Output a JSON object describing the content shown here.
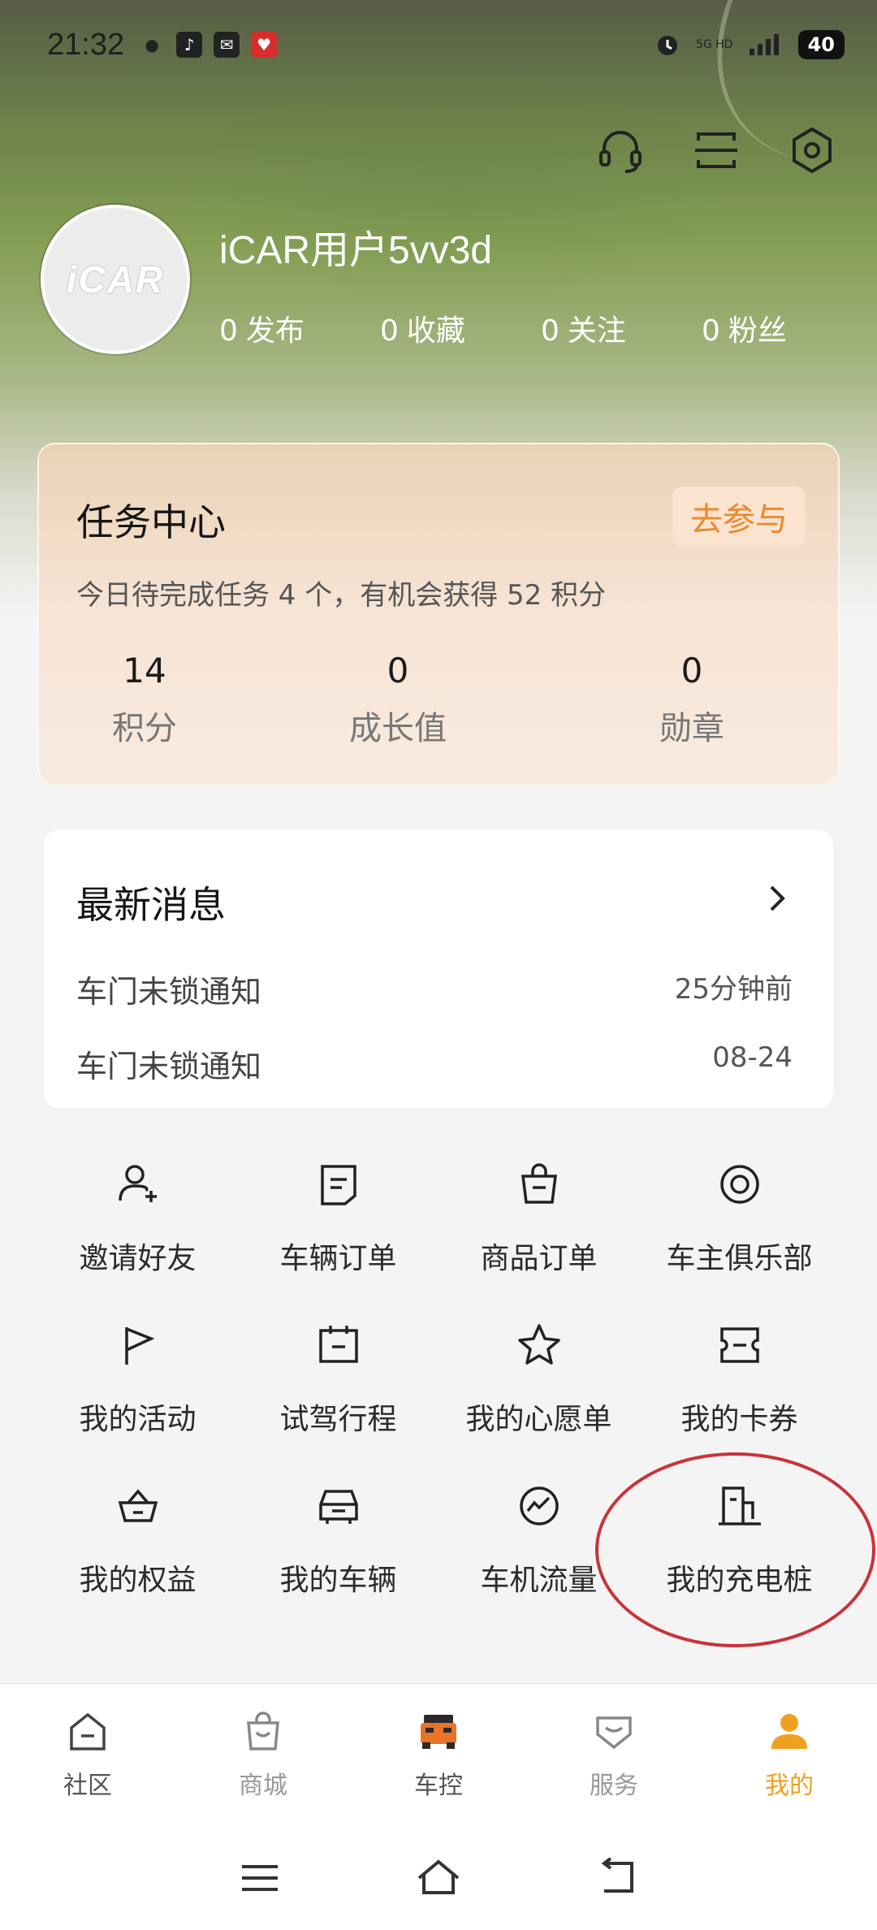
{
  "status_bar": {
    "time": "21:32",
    "network": "5G HD",
    "battery": "40"
  },
  "profile": {
    "avatar_text": "iCAR",
    "username": "iCAR用户5vv3d",
    "stats": [
      {
        "num": "0",
        "label": "发布"
      },
      {
        "num": "0",
        "label": "收藏"
      },
      {
        "num": "0",
        "label": "关注"
      },
      {
        "num": "0",
        "label": "粉丝"
      }
    ]
  },
  "task_center": {
    "title": "任务中心",
    "join_label": "去参与",
    "description": "今日待完成任务 4 个，有机会获得 52 积分",
    "stats": [
      {
        "value": "14",
        "label": "积分"
      },
      {
        "value": "0",
        "label": "成长值"
      },
      {
        "value": "0",
        "label": "勋章"
      }
    ]
  },
  "messages": {
    "title": "最新消息",
    "items": [
      {
        "text": "车门未锁通知",
        "time": "25分钟前"
      },
      {
        "text": "车门未锁通知",
        "time": "08-24"
      }
    ]
  },
  "menu": {
    "items": [
      {
        "label": "邀请好友",
        "icon": "invite-friend-icon"
      },
      {
        "label": "车辆订单",
        "icon": "vehicle-order-icon"
      },
      {
        "label": "商品订单",
        "icon": "product-order-icon"
      },
      {
        "label": "车主俱乐部",
        "icon": "owner-club-icon"
      },
      {
        "label": "我的活动",
        "icon": "flag-icon"
      },
      {
        "label": "试驾行程",
        "icon": "calendar-icon"
      },
      {
        "label": "我的心愿单",
        "icon": "star-icon"
      },
      {
        "label": "我的卡券",
        "icon": "coupon-icon"
      },
      {
        "label": "我的权益",
        "icon": "crown-basket-icon"
      },
      {
        "label": "我的车辆",
        "icon": "car-icon"
      },
      {
        "label": "车机流量",
        "icon": "data-flow-icon"
      },
      {
        "label": "我的充电桩",
        "icon": "charging-pile-icon"
      }
    ]
  },
  "bottom_nav": {
    "items": [
      {
        "label": "社区",
        "icon": "community-icon"
      },
      {
        "label": "商城",
        "icon": "shop-bag-icon"
      },
      {
        "label": "车控",
        "icon": "car-control-icon"
      },
      {
        "label": "服务",
        "icon": "service-icon"
      },
      {
        "label": "我的",
        "icon": "profile-person-icon",
        "active": true
      }
    ],
    "active_color": "#f0a020"
  },
  "colors": {
    "accent": "#e98a2e",
    "annotation": "#c8333a"
  }
}
